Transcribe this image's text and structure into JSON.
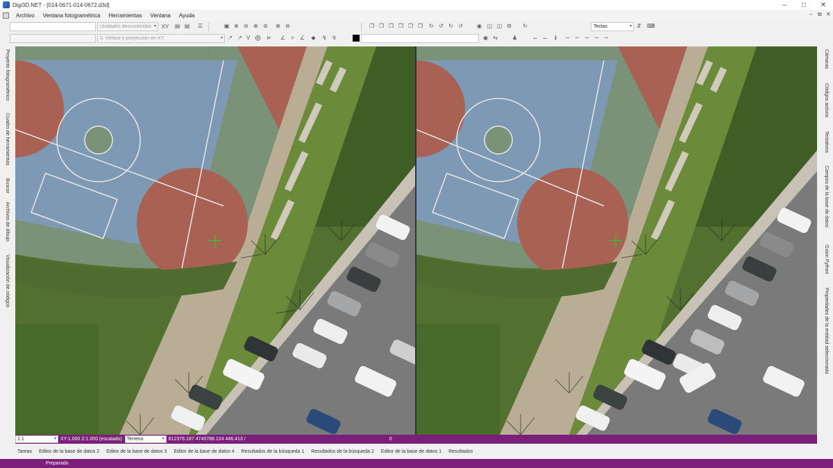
{
  "window": {
    "title": "Digi3D.NET - [014-0671-014-0672.d3d]"
  },
  "menu": [
    "Archivo",
    "Ventana fotogramétrica",
    "Herramientas",
    "Ventana",
    "Ayuda"
  ],
  "toolbar": {
    "units_placeholder": "Unidades desconocidas",
    "xy_label": "XY",
    "keys_value": "Teclas",
    "vertex_placeholder": "0. Vértice o proyección en XY."
  },
  "left_dock_tabs": [
    "Proyecto fotogramétrico",
    "Cuadro de herramientas",
    "Buscar",
    "Archivos de dibujo",
    "Visualización de códigos"
  ],
  "right_dock_tabs": [
    "Cámaras",
    "Códigos activos",
    "Tentativos",
    "Campos de la base de datos",
    "Guion Python",
    "Propiedades de la entidad seleccionada"
  ],
  "status_strip": {
    "scale": "1:1",
    "xy_info": "XY:1.000 Z:1.000 (escalado)",
    "mode": "Terreno",
    "coordinates": "612376.187 4740788.124 446.413 /",
    "value": "0"
  },
  "bottom_tabs": [
    "Tareas",
    "Editor de la base de datos 2",
    "Editor de la base de datos 3",
    "Editor de la base de datos 4",
    "Resultados de la búsqueda 1",
    "Resultados de la búsqueda 2",
    "Editor de la base de datos 1",
    "Resultados"
  ],
  "statusbar": {
    "text": "Preparado"
  },
  "colors": {
    "accent": "#7a1f7a",
    "court_blue": "#7d99b3",
    "court_red": "#a86152",
    "court_green": "#7a9277",
    "grass": "#4f6b2f",
    "road": "#757575"
  }
}
